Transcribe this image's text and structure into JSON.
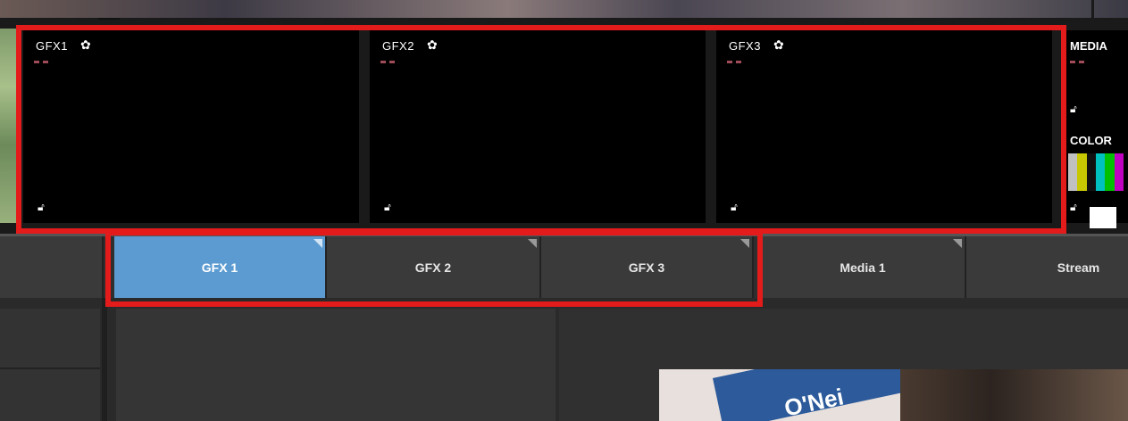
{
  "inputs": {
    "gfx_panels": [
      {
        "title": "GFX1"
      },
      {
        "title": "GFX2"
      },
      {
        "title": "GFX3"
      }
    ],
    "media_panel": {
      "title": "MEDIA"
    },
    "color_panel": {
      "title": "COLOR"
    }
  },
  "tabs": [
    {
      "label": "GFX 1",
      "active": true
    },
    {
      "label": "GFX 2",
      "active": false
    },
    {
      "label": "GFX 3",
      "active": false
    },
    {
      "label": "Media 1",
      "active": false
    },
    {
      "label": "Stream",
      "active": false
    }
  ],
  "preview": {
    "banner_text": "O'Nei"
  },
  "colors": {
    "active_tab": "#5c9bd1",
    "highlight": "#e31b1b",
    "panel_bg": "#000000"
  },
  "icons": {
    "gear": "gear-icon",
    "lock": "lock-icon"
  }
}
